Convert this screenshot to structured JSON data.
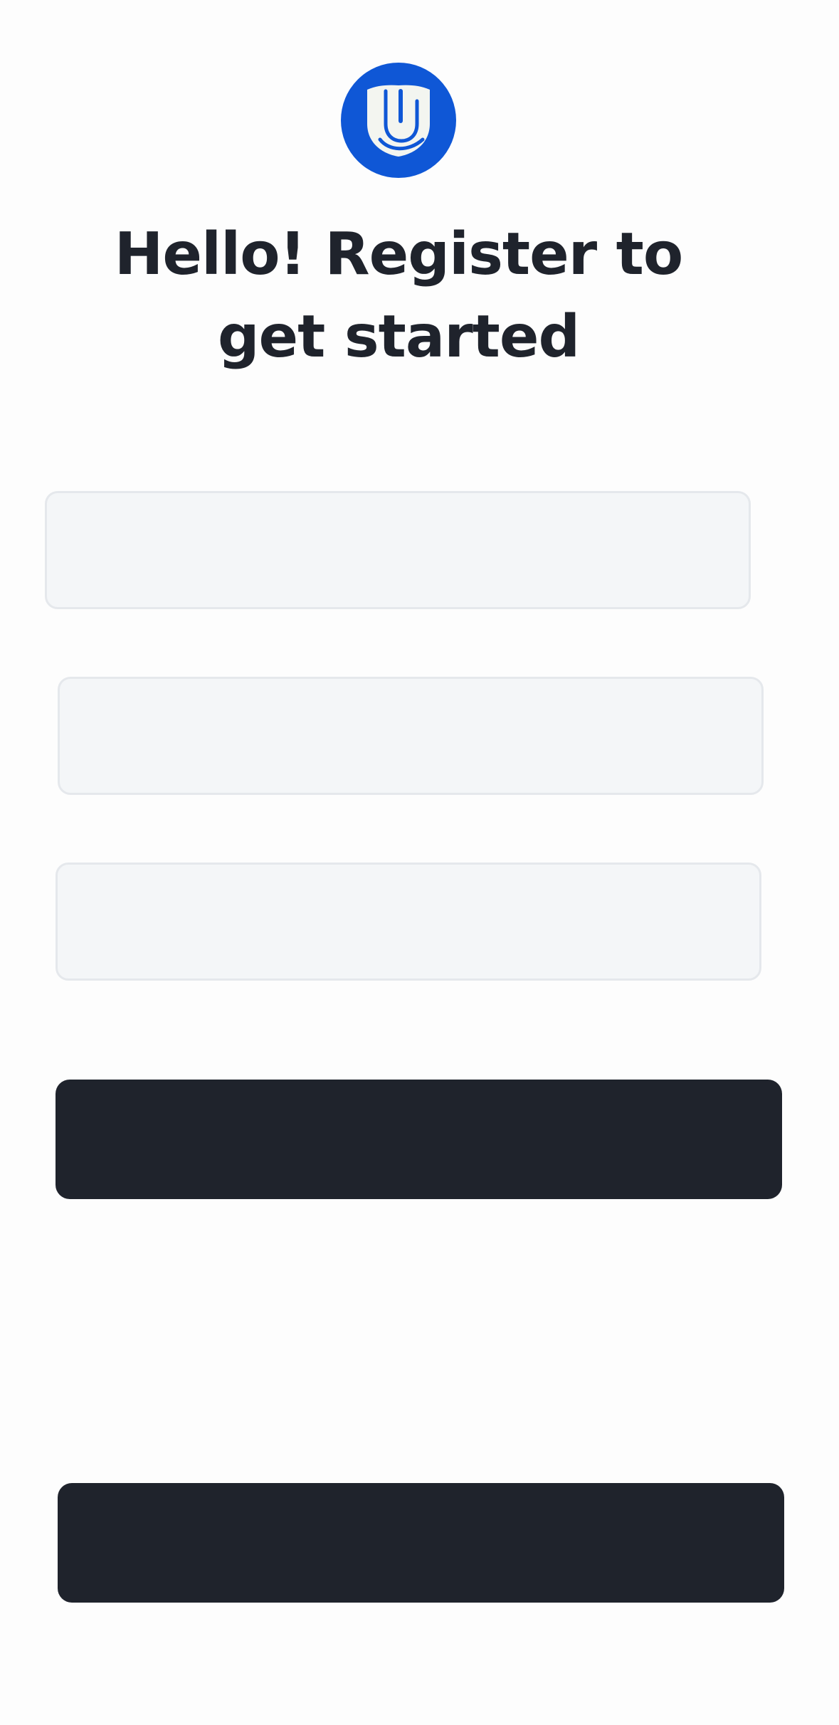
{
  "logo": {
    "icon": "shield-u-icon",
    "background_color": "#0f57d6"
  },
  "heading": {
    "title": "Hello! Register to get started"
  },
  "form": {
    "fields": [
      {
        "placeholder": ""
      },
      {
        "placeholder": ""
      },
      {
        "placeholder": ""
      }
    ]
  },
  "actions": {
    "primary_label": "",
    "secondary_label": ""
  },
  "colors": {
    "accent": "#0f57d6",
    "button": "#1f232c",
    "field_background": "#f4f6f8",
    "field_border": "#e5e8ec",
    "text": "#1f232c"
  }
}
